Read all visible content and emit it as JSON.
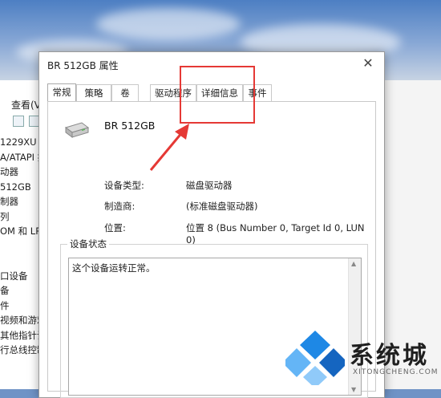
{
  "background": {
    "menu_view": "查看(V)",
    "tree_items": [
      "1229XU",
      "A/ATAPI 控",
      "动器",
      "512GB",
      "制器",
      "列",
      "OM 和 LP",
      "",
      "",
      "口设备",
      "备",
      "件",
      "视频和游戏",
      "其他指针设",
      "行总线控制"
    ]
  },
  "dialog": {
    "title": "BR 512GB 属性",
    "close": "✕",
    "tabs": [
      "常规",
      "策略",
      "卷",
      "驱动程序",
      "详细信息",
      "事件"
    ],
    "active_tab": "常规",
    "device_name": "BR 512GB",
    "properties": [
      {
        "label": "设备类型:",
        "value": "磁盘驱动器"
      },
      {
        "label": "制造商:",
        "value": "(标准磁盘驱动器)"
      },
      {
        "label": "位置:",
        "value": "位置 8 (Bus Number 0, Target Id 0, LUN 0)"
      }
    ],
    "status_group_title": "设备状态",
    "status_text": "这个设备运转正常。"
  },
  "annotation": {
    "color": "#e53935",
    "highlighted_tab": "详细信息"
  },
  "watermark": {
    "brand": "系统城",
    "url": "XITONGCHENG.COM"
  },
  "colors": {
    "accent_blue": "#1e88e5",
    "watermark_blue": "#1565c0",
    "sky": "#4d7fc3"
  }
}
